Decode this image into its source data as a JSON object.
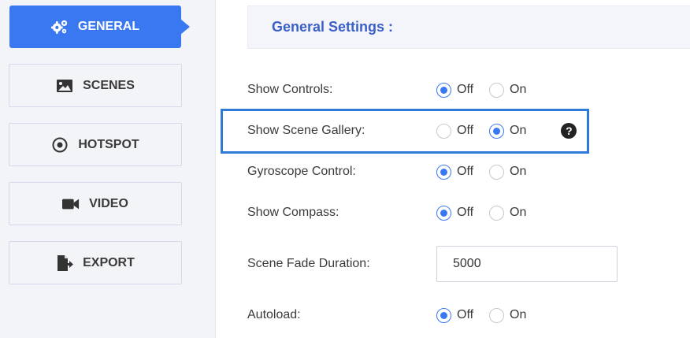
{
  "sidebar": {
    "items": [
      {
        "label": "GENERAL",
        "icon": "gears-icon",
        "active": true
      },
      {
        "label": "SCENES",
        "icon": "image-icon",
        "active": false
      },
      {
        "label": "HOTSPOT",
        "icon": "target-icon",
        "active": false
      },
      {
        "label": "VIDEO",
        "icon": "video-camera-icon",
        "active": false
      },
      {
        "label": "EXPORT",
        "icon": "export-file-icon",
        "active": false
      }
    ]
  },
  "main": {
    "title": "General Settings :",
    "option_off": "Off",
    "option_on": "On",
    "settings": [
      {
        "label": "Show Controls:",
        "value": "Off"
      },
      {
        "label": "Show Scene Gallery:",
        "value": "On"
      },
      {
        "label": "Gyroscope Control:",
        "value": "Off"
      },
      {
        "label": "Show Compass:",
        "value": "Off"
      },
      {
        "label": "Scene Fade Duration:",
        "input_value": "5000"
      },
      {
        "label": "Autoload:",
        "value": "Off"
      }
    ]
  },
  "colors": {
    "accent": "#3a78f2",
    "highlight": "#2f7ad8",
    "title": "#3b5fc9"
  }
}
